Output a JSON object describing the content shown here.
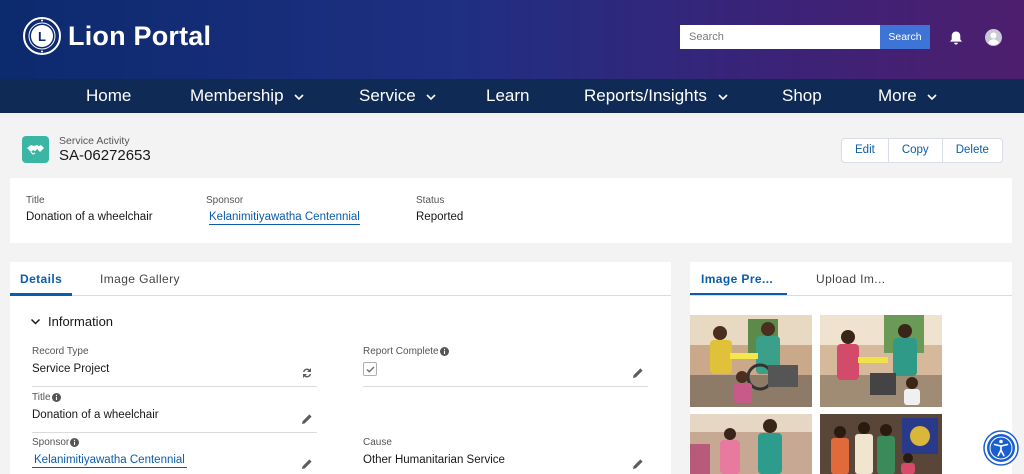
{
  "header": {
    "brand": "Lion Portal",
    "search_placeholder": "Search",
    "search_button": "Search"
  },
  "nav": {
    "items": [
      {
        "label": "Home",
        "dropdown": false
      },
      {
        "label": "Membership",
        "dropdown": true
      },
      {
        "label": "Service",
        "dropdown": true
      },
      {
        "label": "Learn",
        "dropdown": false
      },
      {
        "label": "Reports/Insights",
        "dropdown": true
      },
      {
        "label": "Shop",
        "dropdown": false
      },
      {
        "label": "More",
        "dropdown": true
      }
    ]
  },
  "record": {
    "object_label": "Service Activity",
    "number": "SA-06272653",
    "icon": "handshake-icon",
    "icon_color": "#3bb5a4",
    "actions": [
      "Edit",
      "Copy",
      "Delete"
    ]
  },
  "highlights": [
    {
      "label": "Title",
      "value": "Donation of a wheelchair",
      "link": false
    },
    {
      "label": "Sponsor",
      "value": "Kelanimitiyawatha Centennial",
      "link": true
    },
    {
      "label": "Status",
      "value": "Reported",
      "link": false
    }
  ],
  "details": {
    "tabs": [
      "Details",
      "Image Gallery"
    ],
    "active_tab": "Details",
    "section": "Information",
    "fields": {
      "record_type": {
        "label": "Record Type",
        "value": "Service Project"
      },
      "report_complete": {
        "label": "Report Complete",
        "checked": true
      },
      "title": {
        "label": "Title",
        "value": "Donation of a wheelchair"
      },
      "sponsor": {
        "label": "Sponsor",
        "value": "Kelanimitiyawatha Centennial"
      },
      "cause": {
        "label": "Cause",
        "value": "Other Humanitarian Service"
      }
    }
  },
  "gallery": {
    "tabs": [
      "Image Pre...",
      "Upload Im..."
    ],
    "active_tab": "Image Pre..."
  },
  "colors": {
    "banner_start": "#0c2a6e",
    "banner_end": "#4e1e6e",
    "nav_bg": "#0f2b55",
    "link": "#0b5cab",
    "search_button": "#3e74d6"
  }
}
